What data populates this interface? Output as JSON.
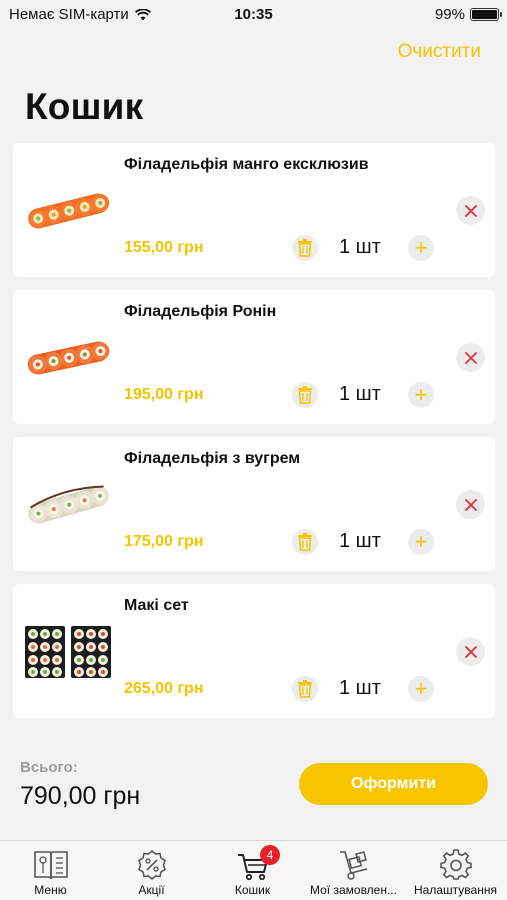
{
  "status_bar": {
    "carrier": "Немає SIM-карти",
    "time": "10:35",
    "battery": "99%",
    "battery_level": 0.99
  },
  "header": {
    "clear_label": "Очистити",
    "title": "Кошик"
  },
  "cart": {
    "items": [
      {
        "name": "Філадельфія манго ексклюзив",
        "price": "155,00 грн",
        "quantity": "1 шт"
      },
      {
        "name": "Філадельфія Ронін",
        "price": "195,00 грн",
        "quantity": "1 шт"
      },
      {
        "name": "Філадельфія з вугрем",
        "price": "175,00 грн",
        "quantity": "1 шт"
      },
      {
        "name": "Макі сет",
        "price": "265,00 грн",
        "quantity": "1 шт"
      }
    ],
    "plus_symbol": "+"
  },
  "footer": {
    "total_label": "Всього:",
    "total_value": "790,00 грн",
    "checkout_label": "Оформити"
  },
  "tab_bar": {
    "tabs": [
      {
        "label": "Меню",
        "icon": "menu-book-icon"
      },
      {
        "label": "Акції",
        "icon": "discount-badge-icon"
      },
      {
        "label": "Кошик",
        "icon": "cart-icon",
        "badge": "4"
      },
      {
        "label": "Мої замовлен...",
        "icon": "hand-truck-icon"
      },
      {
        "label": "Налаштування",
        "icon": "gear-icon"
      }
    ]
  },
  "colors": {
    "accent": "#f5c400",
    "badge": "#e8202a",
    "remove": "#e0303a"
  }
}
